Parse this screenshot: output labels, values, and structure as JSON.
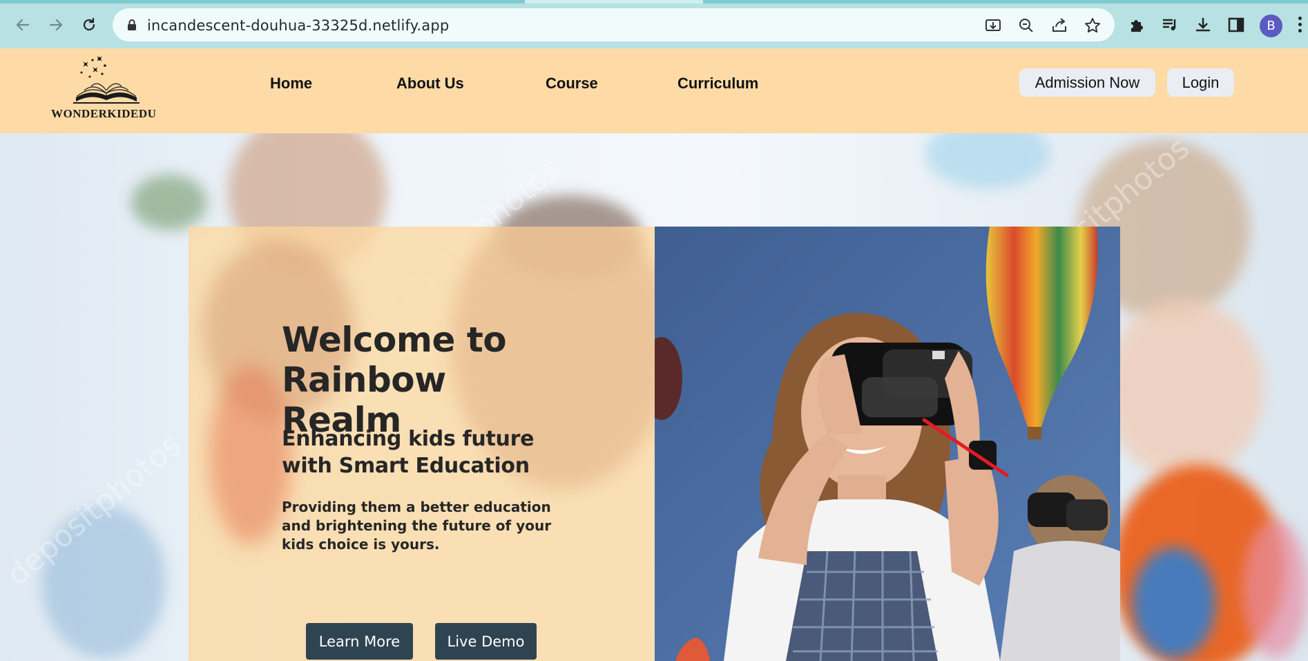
{
  "browser": {
    "url": "incandescent-douhua-33325d.netlify.app",
    "profile_initial": "B",
    "icons": [
      "back-icon",
      "forward-icon",
      "reload-icon",
      "lock-icon",
      "install-app-icon",
      "zoom-icon",
      "share-icon",
      "star-icon",
      "extensions-icon",
      "media-icon",
      "download-icon",
      "side-panel-icon",
      "more-icon"
    ]
  },
  "header": {
    "logo_text": "WONDERKIDEDU",
    "nav": [
      "Home",
      "About Us",
      "Course",
      "Curriculum"
    ],
    "admission_label": "Admission Now",
    "login_label": "Login"
  },
  "hero": {
    "title": "Welcome to Rainbow Realm",
    "subtitle": "Enhancing kids future with Smart Education",
    "description": "Providing them a better education and brightening the future of your kids choice is yours.",
    "learn_more_label": "Learn More",
    "live_demo_label": "Live Demo",
    "watermark_text": "depositphotos"
  },
  "colors": {
    "chrome": "#b7e1e3",
    "header_bg": "#fddaa6",
    "card_overlay": "#fcd8a0",
    "button_dark": "#2f4452"
  }
}
